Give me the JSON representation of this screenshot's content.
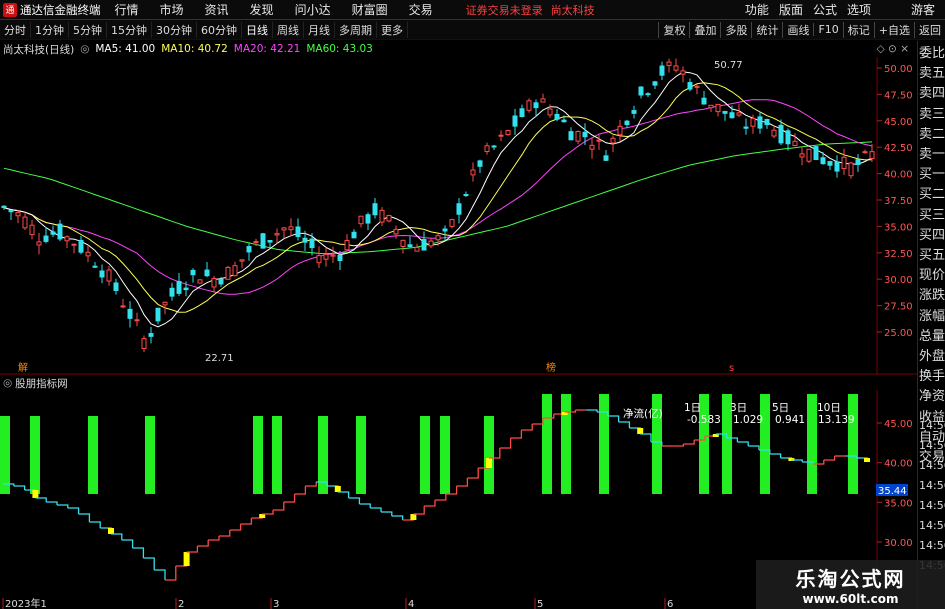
{
  "titlebar": {
    "app_name": "通达信金融终端",
    "menus": [
      "行情",
      "市场",
      "资讯",
      "发现",
      "问小达",
      "财富圈",
      "交易"
    ],
    "notice": "证券交易未登录",
    "stock_name": "尚太科技",
    "right_menus": [
      "功能",
      "版面",
      "公式",
      "选项"
    ],
    "user": "游客"
  },
  "periodbar": {
    "periods": [
      "分时",
      "1分钟",
      "5分钟",
      "15分钟",
      "30分钟",
      "60分钟",
      "日线",
      "周线",
      "月线",
      "多周期",
      "更多"
    ],
    "active": "日线",
    "tools": [
      "复权",
      "叠加",
      "多股",
      "统计",
      "画线",
      "F10",
      "标记",
      "+自选",
      "返回"
    ]
  },
  "infobar": {
    "title": "尚太科技(日线)",
    "ma5": "MA5: 41.00",
    "ma10": "MA10: 40.72",
    "ma20": "MA20: 42.21",
    "ma60": "MA60: 43.03"
  },
  "main_axis": {
    "ticks": [
      "50.00",
      "47.50",
      "45.00",
      "42.50",
      "40.00",
      "37.50",
      "35.00",
      "32.50",
      "30.00",
      "27.50",
      "25.00"
    ]
  },
  "annotations": {
    "high": "50.77",
    "low": "22.71",
    "marker_jie": "解",
    "marker_bang": "榜",
    "marker_s": "s"
  },
  "indicator": {
    "title": "股朋指标网",
    "netflow": "净流(亿)",
    "periods": [
      "1日",
      "3日",
      "5日",
      "10日"
    ],
    "values": [
      "-0.583",
      "1.029",
      "0.941",
      "13.139"
    ],
    "ticks": [
      "45.00",
      "40.00",
      "35.00",
      "30.00"
    ],
    "current": "35.44"
  },
  "time_axis": {
    "labels": [
      "2023年1",
      "2",
      "3",
      "4",
      "5",
      "6"
    ]
  },
  "rightpanel": {
    "items": [
      "委比",
      "卖五",
      "卖四",
      "卖三",
      "卖二",
      "卖一",
      "买一",
      "买二",
      "买三",
      "买四",
      "买五",
      "现价",
      "涨跌",
      "涨幅",
      "总量",
      "外盘",
      "换手",
      "净资",
      "收益",
      "自动",
      "交易"
    ],
    "prices": [
      "14:56",
      "14:56",
      "14:56",
      "14:56",
      "14:56",
      "14:56",
      "14:56",
      "14:56"
    ]
  },
  "watermark": {
    "title": "乐淘公式网",
    "url": "www.60lt.com"
  },
  "colors": {
    "up": "#ff4a4a",
    "down": "#33e0ee",
    "ma5": "#ffffff",
    "ma10": "#ffff55",
    "ma20": "#ff44ff",
    "ma60": "#44ff44",
    "bar_green": "#22ee22"
  }
}
